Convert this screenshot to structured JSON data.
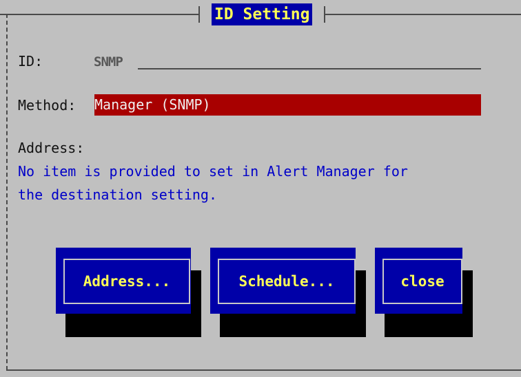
{
  "dialog": {
    "title": "ID Setting"
  },
  "fields": {
    "id_label": "ID:",
    "id_value": "SNMP",
    "method_label": "Method:",
    "method_value": "Manager (SNMP)",
    "address_label": "Address:"
  },
  "info": {
    "line1": "No item is provided to set in Alert Manager for",
    "line2": "the destination setting."
  },
  "buttons": {
    "address_label": "Address...",
    "schedule_label": "Schedule...",
    "close_label": "close"
  },
  "colors": {
    "background": "#c0c0c0",
    "button_face": "#0000a8",
    "button_text": "#ffff55",
    "method_field": "#a80000",
    "info_text": "#0000c8"
  }
}
